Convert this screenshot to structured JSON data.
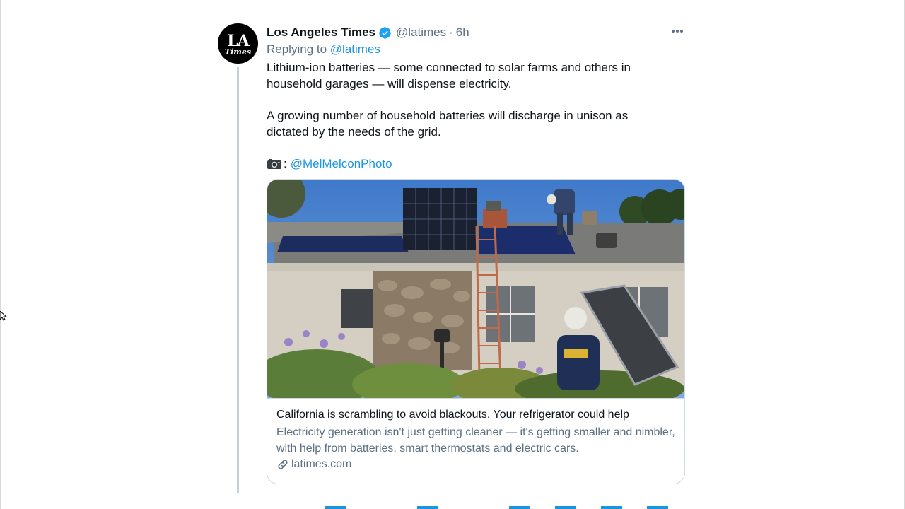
{
  "tweet": {
    "author_name": "Los Angeles Times",
    "author_handle": "@latimes",
    "separator": "·",
    "time": "6h",
    "replying_prefix": "Replying to",
    "replying_to": "@latimes",
    "paragraph1": "Lithium-ion batteries — some connected to solar farms and others in household garages — will dispense electricity.",
    "paragraph2": "A growing number of household batteries will discharge in unison as dictated by the needs of the grid.",
    "photo_credit_sep": ":",
    "photo_credit": "@MelMelconPhoto",
    "avatar": {
      "line1": "LA",
      "line2": "Times"
    }
  },
  "card": {
    "title": "California is scrambling to avoid blackouts. Your refrigerator could help",
    "description": "Electricity generation isn't just getting cleaner — it's getting smaller and nimbler, with help from batteries, smart thermostats and electric cars.",
    "domain": "latimes.com",
    "image_icon": "photo-solar-roof"
  },
  "icons": {
    "verified": "verified-badge-icon",
    "more": "more-options-icon",
    "camera": "camera-icon",
    "link": "link-icon"
  },
  "colors": {
    "link": "#1b95e0",
    "secondary_text": "#5b7083",
    "primary_text": "#0f1419",
    "verified": "#1da1f2"
  }
}
